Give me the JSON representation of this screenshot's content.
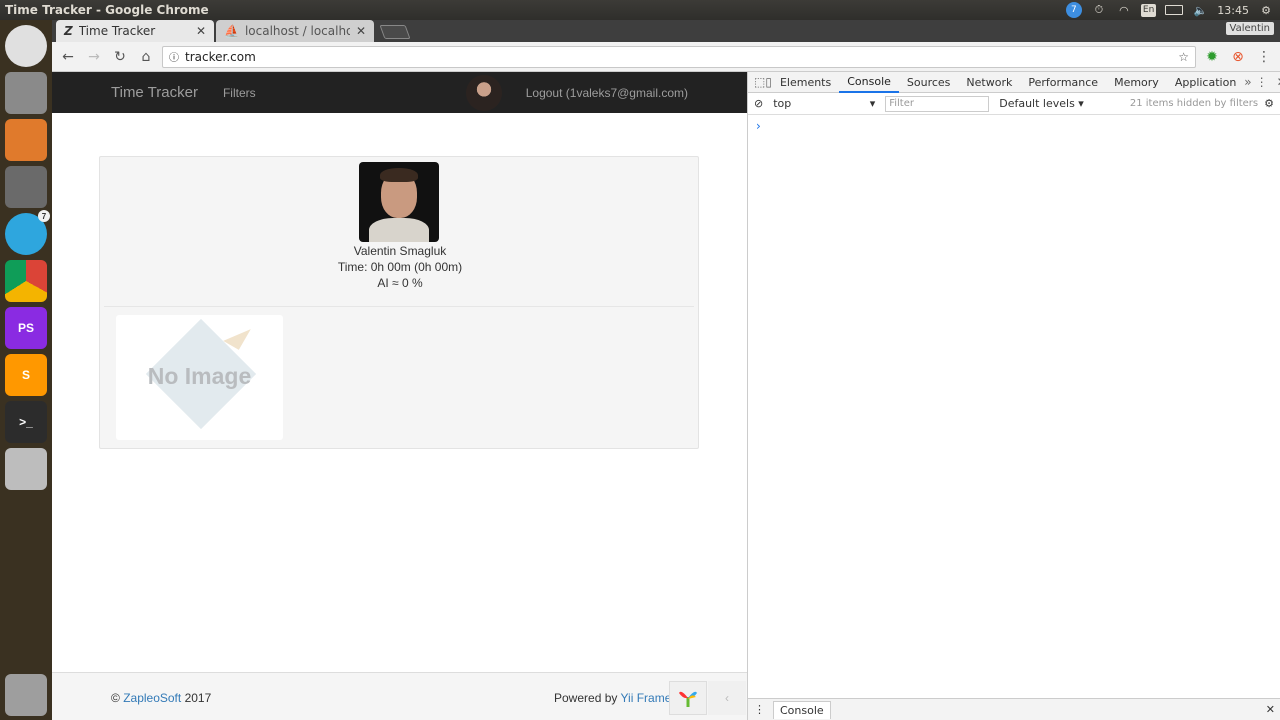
{
  "os": {
    "window_title": "Time Tracker - Google Chrome",
    "tray": {
      "notification_count": "7",
      "keyboard": "En",
      "clock": "13:45"
    }
  },
  "launcher": {
    "items": [
      {
        "name": "ubuntu-dash",
        "color": "#e0e0e0"
      },
      {
        "name": "files",
        "color": "#8a8a8a"
      },
      {
        "name": "software-center",
        "color": "#e07a2c"
      },
      {
        "name": "system-settings",
        "color": "#6a6a6a"
      },
      {
        "name": "telegram",
        "color": "#2ea6de",
        "badge": "7"
      },
      {
        "name": "chrome",
        "color": "#ffffff"
      },
      {
        "name": "phpstorm",
        "color": "#8a2be2",
        "label": "PS"
      },
      {
        "name": "sublime-text",
        "color": "#ff9800",
        "label": "S"
      },
      {
        "name": "terminal",
        "color": "#2c2c2c",
        "label": ">_"
      },
      {
        "name": "disk",
        "color": "#bdbdbd"
      },
      {
        "name": "trash",
        "color": "#9e9e9e"
      }
    ]
  },
  "browser": {
    "tabs": [
      {
        "title": "Time Tracker",
        "active": true
      },
      {
        "title": "localhost / localhos",
        "active": false
      }
    ],
    "profile": "Valentin",
    "url": "tracker.com"
  },
  "page": {
    "navbar": {
      "brand": "Time Tracker",
      "filters": "Filters",
      "logout": "Logout (1valeks7@gmail.com)"
    },
    "user": {
      "name": "Valentin Smagluk",
      "time": "Time: 0h 00m (0h 00m)",
      "ai": "AI ≈ 0 %"
    },
    "screenshot_placeholder": "No Image",
    "footer": {
      "copyright": "©",
      "company": "ZapleoSoft",
      "year": "2017",
      "powered": "Powered by",
      "framework": "Yii Framew"
    }
  },
  "devtools": {
    "tabs": [
      "Elements",
      "Console",
      "Sources",
      "Network",
      "Performance",
      "Memory",
      "Application"
    ],
    "active_tab": "Console",
    "context": "top",
    "filter_placeholder": "Filter",
    "levels": "Default levels",
    "hidden_count": "21 items hidden by filters",
    "prompt": "›",
    "drawer_tab": "Console"
  }
}
